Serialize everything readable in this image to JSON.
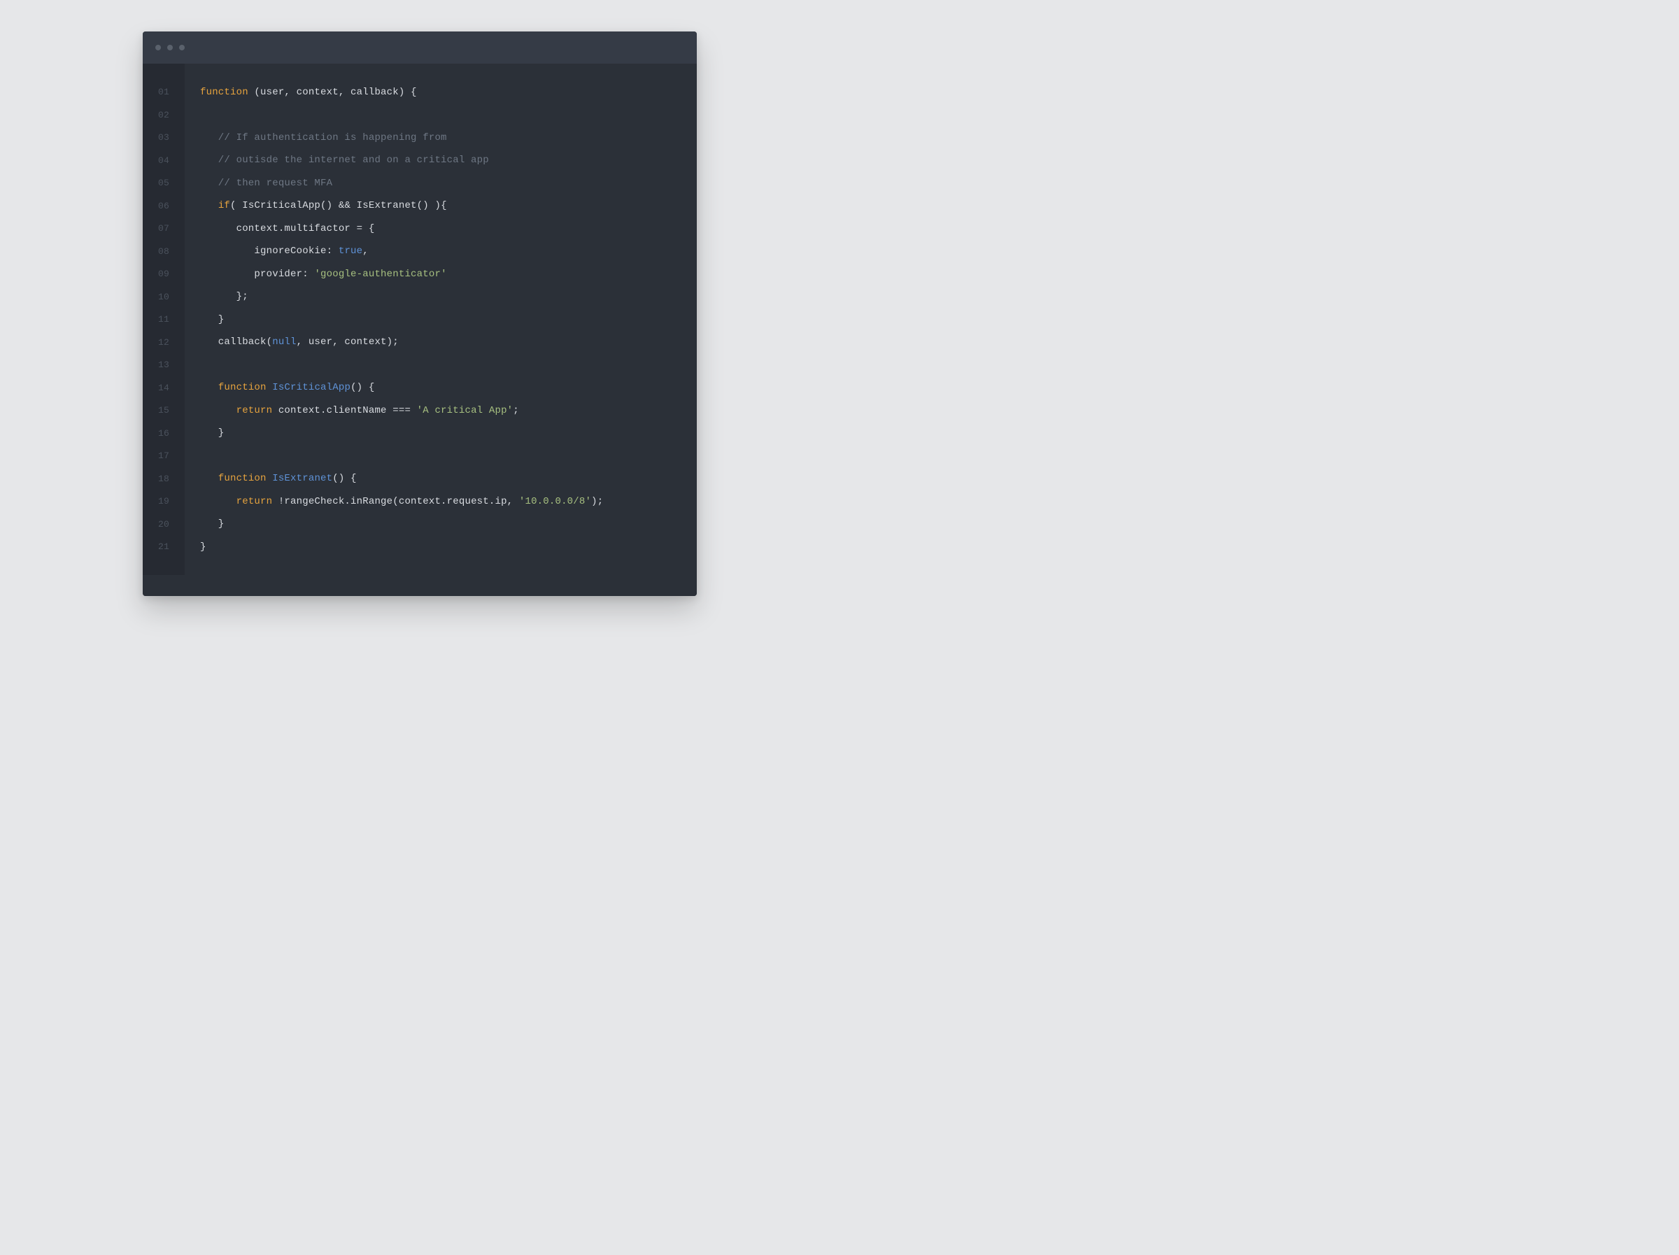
{
  "colors": {
    "page_bg": "#e6e7e9",
    "titlebar_bg": "#353b46",
    "editor_bg": "#2b3038",
    "gutter_bg": "#262a32",
    "gutter_fg": "#4b525d",
    "default_fg": "#d9dce1",
    "keyword": "#e6a33e",
    "function_name": "#5f93d8",
    "boolean": "#5f93d8",
    "null": "#5f93d8",
    "string": "#a7c080",
    "comment": "#6e7784"
  },
  "traffic_dots": 3,
  "lines": [
    {
      "num": "01",
      "tokens": [
        {
          "t": "function",
          "c": "keyword"
        },
        {
          "t": " (user, context, callback) {",
          "c": "default"
        }
      ]
    },
    {
      "num": "02",
      "tokens": []
    },
    {
      "num": "03",
      "tokens": [
        {
          "t": "   // If authentication is happening from",
          "c": "comment"
        }
      ]
    },
    {
      "num": "04",
      "tokens": [
        {
          "t": "   // outisde the internet and on a critical app",
          "c": "comment"
        }
      ]
    },
    {
      "num": "05",
      "tokens": [
        {
          "t": "   // then request MFA",
          "c": "comment"
        }
      ]
    },
    {
      "num": "06",
      "tokens": [
        {
          "t": "   ",
          "c": "default"
        },
        {
          "t": "if",
          "c": "keyword"
        },
        {
          "t": "( IsCriticalApp() && IsExtranet() ){",
          "c": "default"
        }
      ]
    },
    {
      "num": "07",
      "tokens": [
        {
          "t": "      context.multifactor = {",
          "c": "default"
        }
      ]
    },
    {
      "num": "08",
      "tokens": [
        {
          "t": "         ignoreCookie: ",
          "c": "default"
        },
        {
          "t": "true",
          "c": "bool"
        },
        {
          "t": ",",
          "c": "default"
        }
      ]
    },
    {
      "num": "09",
      "tokens": [
        {
          "t": "         provider: ",
          "c": "default"
        },
        {
          "t": "'google-authenticator'",
          "c": "string"
        }
      ]
    },
    {
      "num": "10",
      "tokens": [
        {
          "t": "      };",
          "c": "default"
        }
      ]
    },
    {
      "num": "11",
      "tokens": [
        {
          "t": "   }",
          "c": "default"
        }
      ]
    },
    {
      "num": "12",
      "tokens": [
        {
          "t": "   callback(",
          "c": "default"
        },
        {
          "t": "null",
          "c": "null"
        },
        {
          "t": ", user, context);",
          "c": "default"
        }
      ]
    },
    {
      "num": "13",
      "tokens": []
    },
    {
      "num": "14",
      "tokens": [
        {
          "t": "   ",
          "c": "default"
        },
        {
          "t": "function",
          "c": "keyword"
        },
        {
          "t": " ",
          "c": "default"
        },
        {
          "t": "IsCriticalApp",
          "c": "fn"
        },
        {
          "t": "() {",
          "c": "default"
        }
      ]
    },
    {
      "num": "15",
      "tokens": [
        {
          "t": "      ",
          "c": "default"
        },
        {
          "t": "return",
          "c": "keyword"
        },
        {
          "t": " context.clientName === ",
          "c": "default"
        },
        {
          "t": "'A critical App'",
          "c": "string"
        },
        {
          "t": ";",
          "c": "default"
        }
      ]
    },
    {
      "num": "16",
      "tokens": [
        {
          "t": "   }",
          "c": "default"
        }
      ]
    },
    {
      "num": "17",
      "tokens": []
    },
    {
      "num": "18",
      "tokens": [
        {
          "t": "   ",
          "c": "default"
        },
        {
          "t": "function",
          "c": "keyword"
        },
        {
          "t": " ",
          "c": "default"
        },
        {
          "t": "IsExtranet",
          "c": "fn"
        },
        {
          "t": "() {",
          "c": "default"
        }
      ]
    },
    {
      "num": "19",
      "tokens": [
        {
          "t": "      ",
          "c": "default"
        },
        {
          "t": "return",
          "c": "keyword"
        },
        {
          "t": " !rangeCheck.inRange(context.request.ip, ",
          "c": "default"
        },
        {
          "t": "'10.0.0.0/8'",
          "c": "string"
        },
        {
          "t": ");",
          "c": "default"
        }
      ]
    },
    {
      "num": "20",
      "tokens": [
        {
          "t": "   }",
          "c": "default"
        }
      ]
    },
    {
      "num": "21",
      "tokens": [
        {
          "t": "}",
          "c": "default"
        }
      ]
    }
  ]
}
